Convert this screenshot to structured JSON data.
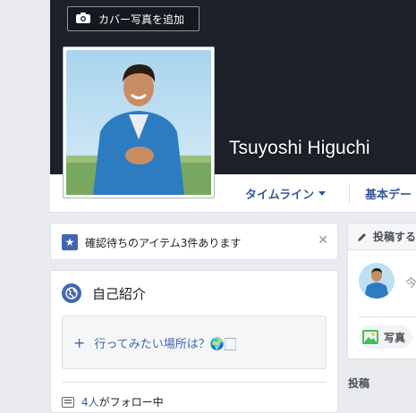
{
  "cover": {
    "add_cover_label": "カバー写真を追加"
  },
  "profile": {
    "name": "Tsuyoshi Higuchi"
  },
  "nav": {
    "timeline_label": "タイムライン",
    "basic_data_label": "基本デー"
  },
  "notice": {
    "text": "確認待ちのアイテム3件あります"
  },
  "intro": {
    "title": "自己紹介",
    "add_prompt": "行ってみたい場所は？🌍🏻",
    "follow_count": "4人",
    "follow_suffix": "がフォロー中"
  },
  "composer": {
    "title": "投稿する",
    "placeholder": "今",
    "photo_label": "写真"
  },
  "posts": {
    "label": "投稿"
  },
  "colors": {
    "accent": "#4267b2",
    "link": "#365899",
    "cover": "#1d2129",
    "background": "#e9ebee"
  },
  "icons": [
    "camera-icon",
    "star-icon",
    "close-icon",
    "globe-icon",
    "plus-icon",
    "follow-icon",
    "pencil-icon",
    "photo-icon",
    "chevron-down-icon"
  ]
}
